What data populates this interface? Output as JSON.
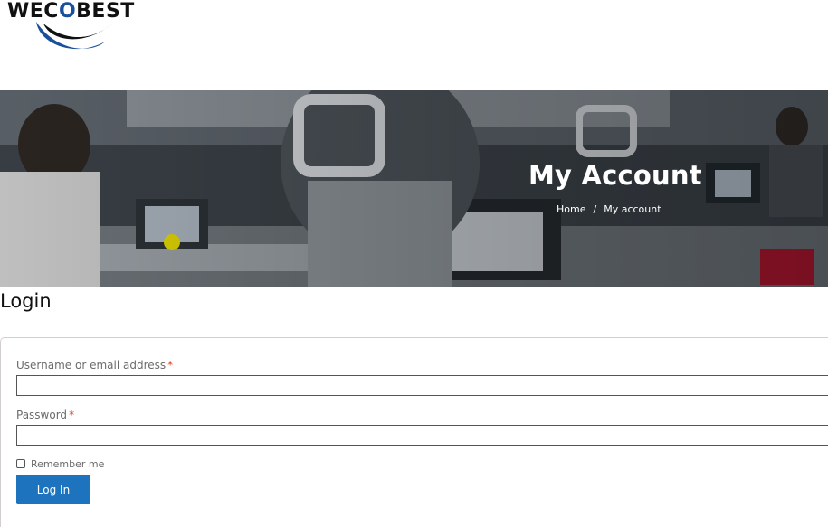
{
  "brand": {
    "name_part1": "WEC",
    "name_accent": "O",
    "name_part2": "BEST",
    "accent_color": "#1b4f9c"
  },
  "hero": {
    "title": "My Account",
    "breadcrumb": {
      "home": "Home",
      "separator": "/",
      "current": "My account"
    }
  },
  "login": {
    "heading": "Login",
    "username_label": "Username or email address",
    "password_label": "Password",
    "required_mark": "*",
    "username_value": "",
    "password_value": "",
    "remember_label": "Remember me",
    "remember_checked": false,
    "submit_label": "Log In",
    "button_color": "#1e73be"
  }
}
